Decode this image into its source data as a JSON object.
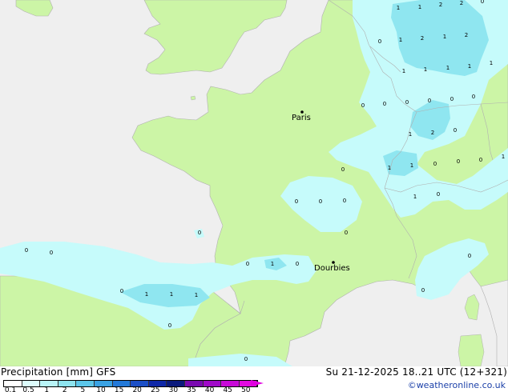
{
  "colors": {
    "sea": "#efefef",
    "land": "#ccf5a6",
    "rain_light": "#c6fbfb",
    "rain_medium": "#8fe6f0",
    "borders": "#b0b0b0"
  },
  "cities": [
    {
      "name": "Paris",
      "icon": "city-dot-icon"
    },
    {
      "name": "Dourbies",
      "icon": "city-dot-icon"
    }
  ],
  "values": [
    "1",
    "1",
    "2",
    "2",
    "0",
    "0",
    "1",
    "2",
    "1",
    "2",
    "1",
    "1",
    "1",
    "1",
    "1",
    "0",
    "0",
    "0",
    "0",
    "0",
    "0",
    "1",
    "2",
    "0",
    "1",
    "1",
    "0",
    "0",
    "0",
    "1",
    "1",
    "0",
    "0",
    "0",
    "0",
    "0",
    "0",
    "0",
    "0",
    "0",
    "1",
    "0",
    "0",
    "1",
    "1",
    "1",
    "0",
    "0",
    "0",
    "0",
    "0"
  ],
  "footer": {
    "title": "Precipitation [mm] GFS",
    "datetime": "Su 21-12-2025 18..21 UTC (12+321)",
    "credit": "©weatheronline.co.uk"
  },
  "legend": {
    "colors": [
      "#fefefe",
      "#dcfbfb",
      "#b9f4f7",
      "#8ee4ef",
      "#5cc6e9",
      "#3aa2e3",
      "#2379d8",
      "#1c4fc6",
      "#0f28a8",
      "#0b1a7c",
      "#7a0ab0",
      "#a00ac8",
      "#c80ad8",
      "#e20ae0"
    ],
    "ticks": [
      "0.1",
      "0.5",
      "1",
      "2",
      "5",
      "10",
      "15",
      "20",
      "25",
      "30",
      "35",
      "40",
      "45",
      "50"
    ]
  }
}
